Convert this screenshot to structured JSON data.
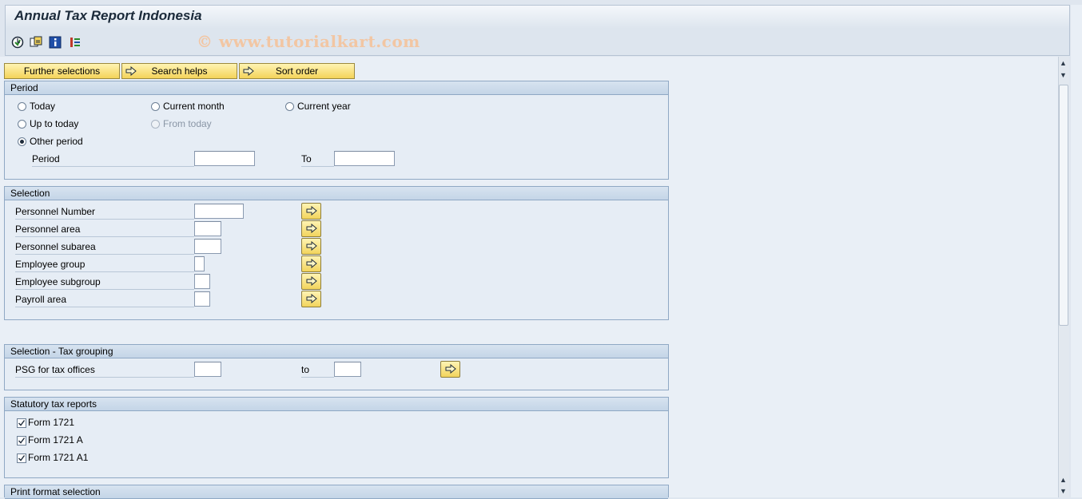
{
  "window": {
    "title": "Annual Tax Report Indonesia",
    "watermark": "© www.tutorialkart.com"
  },
  "toolbar": {
    "icons": [
      "execute-icon",
      "get-variant-icon",
      "information-icon",
      "selection-options-icon"
    ]
  },
  "buttons": {
    "further_selections": "Further selections",
    "search_helps": "Search helps",
    "sort_order": "Sort order"
  },
  "period": {
    "header": "Period",
    "options": {
      "today": "Today",
      "current_month": "Current month",
      "current_year": "Current year",
      "up_to_today": "Up to today",
      "from_today": "From today",
      "other_period": "Other period"
    },
    "selected": "other_period",
    "period_label": "Period",
    "to_label": "To",
    "from_value": "",
    "to_value": ""
  },
  "selection": {
    "header": "Selection",
    "fields": [
      {
        "label": "Personnel Number",
        "value": ""
      },
      {
        "label": "Personnel area",
        "value": ""
      },
      {
        "label": "Personnel subarea",
        "value": ""
      },
      {
        "label": "Employee group",
        "value": ""
      },
      {
        "label": "Employee subgroup",
        "value": ""
      },
      {
        "label": "Payroll area",
        "value": ""
      }
    ]
  },
  "tax_grouping": {
    "header": "Selection - Tax grouping",
    "label": "PSG for tax offices",
    "to_label": "to",
    "from_value": "",
    "to_value": ""
  },
  "statutory": {
    "header": "Statutory tax reports",
    "items": [
      {
        "label": "Form 1721",
        "checked": true
      },
      {
        "label": "Form 1721 A",
        "checked": true
      },
      {
        "label": "Form 1721 A1",
        "checked": true
      }
    ]
  },
  "print_format": {
    "header": "Print format selection"
  }
}
